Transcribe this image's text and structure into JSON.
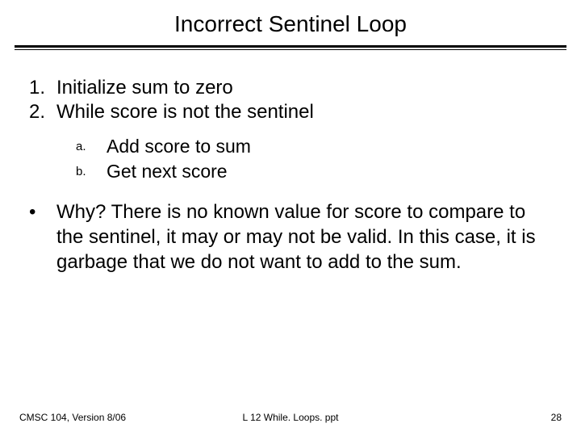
{
  "title": "Incorrect Sentinel Loop",
  "steps": [
    {
      "n": "1.",
      "text": "Initialize sum to zero"
    },
    {
      "n": "2.",
      "text": "While score is not the sentinel"
    }
  ],
  "substeps": [
    {
      "m": "a.",
      "text": "Add score to sum"
    },
    {
      "m": "b.",
      "text": "Get next score"
    }
  ],
  "bullet": {
    "dot": "•",
    "text": "Why?  There is no known value for score to compare to the sentinel, it may or may not be valid.  In this case, it is garbage that we do not want to add to the sum."
  },
  "footer": {
    "left": "CMSC 104, Version 8/06",
    "center": "L 12 While. Loops. ppt",
    "right": "28"
  }
}
